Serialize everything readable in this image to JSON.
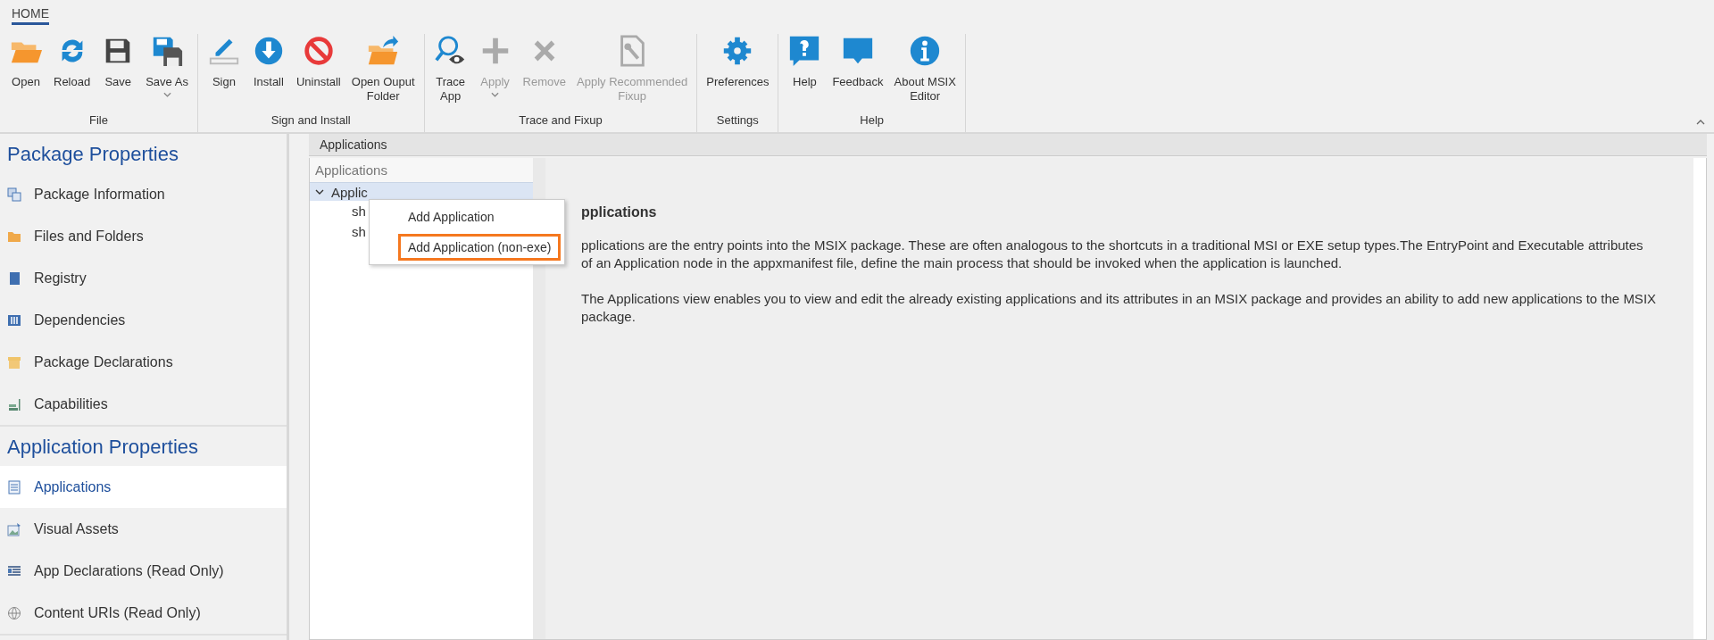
{
  "ribbon": {
    "tabs": [
      {
        "label": "HOME",
        "selected": true
      }
    ],
    "groups": [
      {
        "label": "File",
        "buttons": [
          {
            "kind": "open",
            "lines": [
              "Open"
            ],
            "disabled": false,
            "dropdown": false
          },
          {
            "kind": "reload",
            "lines": [
              "Reload"
            ],
            "disabled": false,
            "dropdown": false
          },
          {
            "kind": "save",
            "lines": [
              "Save"
            ],
            "disabled": false,
            "dropdown": false
          },
          {
            "kind": "saveas",
            "lines": [
              "Save As"
            ],
            "disabled": false,
            "dropdown": true
          }
        ]
      },
      {
        "label": "Sign and Install",
        "buttons": [
          {
            "kind": "sign",
            "lines": [
              "Sign"
            ],
            "disabled": false,
            "dropdown": false
          },
          {
            "kind": "install",
            "lines": [
              "Install"
            ],
            "disabled": false,
            "dropdown": false
          },
          {
            "kind": "uninstall",
            "lines": [
              "Uninstall"
            ],
            "disabled": false,
            "dropdown": false
          },
          {
            "kind": "folderout",
            "lines": [
              "Open Ouput",
              "Folder"
            ],
            "disabled": false,
            "dropdown": false
          }
        ]
      },
      {
        "label": "Trace and Fixup",
        "buttons": [
          {
            "kind": "trace",
            "lines": [
              "Trace",
              "App"
            ],
            "disabled": false,
            "dropdown": false
          },
          {
            "kind": "plus",
            "lines": [
              "Apply"
            ],
            "disabled": true,
            "dropdown": true
          },
          {
            "kind": "cross",
            "lines": [
              "Remove"
            ],
            "disabled": true,
            "dropdown": false
          },
          {
            "kind": "fixup",
            "lines": [
              "Apply Recommended",
              "Fixup"
            ],
            "disabled": true,
            "dropdown": false
          }
        ]
      },
      {
        "label": "Settings",
        "buttons": [
          {
            "kind": "gear",
            "lines": [
              "Preferences"
            ],
            "disabled": false,
            "dropdown": false
          }
        ]
      },
      {
        "label": "Help",
        "buttons": [
          {
            "kind": "help",
            "lines": [
              "Help"
            ],
            "disabled": false,
            "dropdown": false
          },
          {
            "kind": "feedback",
            "lines": [
              "Feedback"
            ],
            "disabled": false,
            "dropdown": false
          },
          {
            "kind": "info",
            "lines": [
              "About MSIX",
              "Editor"
            ],
            "disabled": false,
            "dropdown": false
          }
        ]
      }
    ]
  },
  "sidebar": {
    "sections": [
      {
        "title": "Package Properties",
        "items": [
          {
            "kind": "pkginfo",
            "label": "Package Information",
            "selected": false
          },
          {
            "kind": "folder",
            "label": "Files and Folders",
            "selected": false
          },
          {
            "kind": "book",
            "label": "Registry",
            "selected": false
          },
          {
            "kind": "columns",
            "label": "Dependencies",
            "selected": false
          },
          {
            "kind": "box",
            "label": "Package Declarations",
            "selected": false
          },
          {
            "kind": "bars",
            "label": "Capabilities",
            "selected": false
          }
        ]
      },
      {
        "title": "Application Properties",
        "items": [
          {
            "kind": "doc",
            "label": "Applications",
            "selected": true
          },
          {
            "kind": "image",
            "label": "Visual Assets",
            "selected": false
          },
          {
            "kind": "list",
            "label": "App Declarations (Read Only)",
            "selected": false
          },
          {
            "kind": "globe",
            "label": "Content URIs (Read Only)",
            "selected": false
          }
        ]
      }
    ]
  },
  "page": {
    "title": "Applications",
    "tree": {
      "header": "Applications",
      "nodes": [
        {
          "label": "Applic",
          "expanded": true,
          "selected": true,
          "children": [
            {
              "label": "sh"
            },
            {
              "label": "sh"
            }
          ]
        }
      ]
    },
    "context_menu": [
      {
        "label": "Add Application",
        "selected": false
      },
      {
        "label": "Add Application (non-exe)",
        "selected": true
      }
    ],
    "heading": "pplications",
    "paragraphs": [
      "pplications are the entry points into the MSIX package. These are often analogous to the shortcuts in a traditional MSI or EXE setup types.The EntryPoint and Executable attributes of an Application node in the appxmanifest file, define the main process that should be invoked when the application is launched.",
      "The Applications view enables you to view and edit the already existing applications and its attributes in an MSIX package and provides an ability to add new applications to the MSIX package."
    ]
  }
}
